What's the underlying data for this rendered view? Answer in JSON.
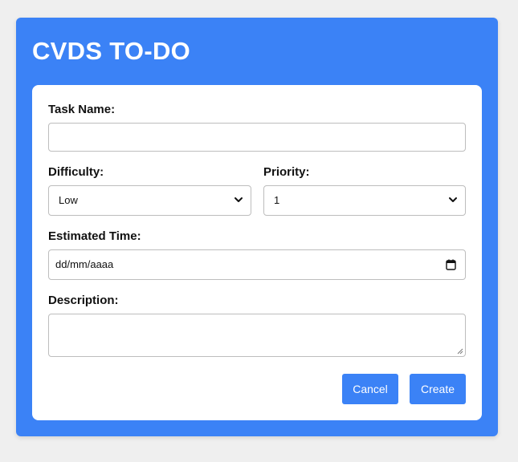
{
  "app": {
    "title": "CVDS TO-DO"
  },
  "form": {
    "task_name": {
      "label": "Task Name:",
      "value": ""
    },
    "difficulty": {
      "label": "Difficulty:",
      "selected": "Low"
    },
    "priority": {
      "label": "Priority:",
      "selected": "1"
    },
    "estimated_time": {
      "label": "Estimated Time:",
      "placeholder": "dd/mm/aaaa"
    },
    "description": {
      "label": "Description:",
      "value": ""
    }
  },
  "actions": {
    "cancel_label": "Cancel",
    "create_label": "Create"
  },
  "colors": {
    "accent": "#3b82f6",
    "page_background": "#efefef",
    "card_background": "#ffffff",
    "field_border": "#bdbdbd"
  },
  "icons": {
    "select_arrow": "chevron-down-icon",
    "date_picker": "calendar-icon",
    "textarea_resize": "resize-handle-icon"
  }
}
